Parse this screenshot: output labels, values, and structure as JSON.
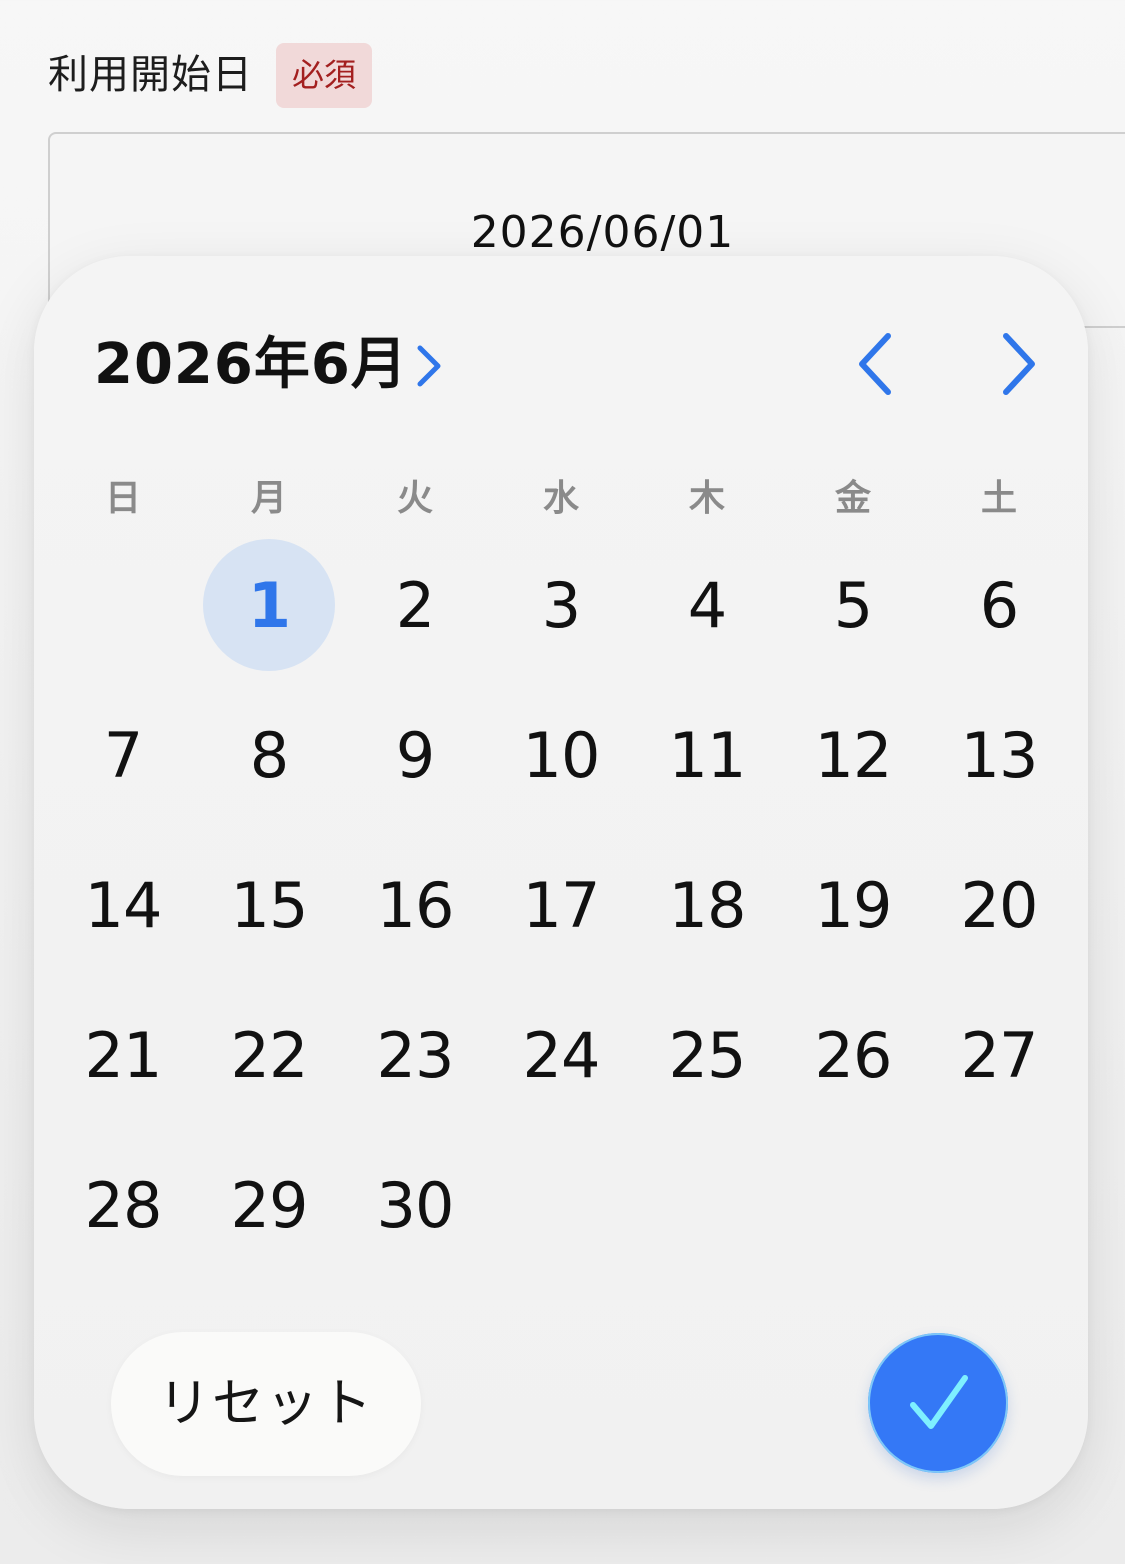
{
  "field": {
    "label": "利用開始日",
    "required_badge": "必須",
    "value": "2026/06/01"
  },
  "calendar": {
    "month_title": "2026年6月",
    "expand_icon": "chevron-right-icon",
    "prev_icon": "chevron-left-icon",
    "next_icon": "chevron-right-icon",
    "weekdays": [
      "日",
      "月",
      "火",
      "水",
      "木",
      "金",
      "土"
    ],
    "leading_blank_days": 1,
    "days_in_month": 30,
    "selected_day": "1",
    "days": [
      "1",
      "2",
      "3",
      "4",
      "5",
      "6",
      "7",
      "8",
      "9",
      "10",
      "11",
      "12",
      "13",
      "14",
      "15",
      "16",
      "17",
      "18",
      "19",
      "20",
      "21",
      "22",
      "23",
      "24",
      "25",
      "26",
      "27",
      "28",
      "29",
      "30"
    ]
  },
  "footer": {
    "reset_label": "リセット",
    "confirm_icon": "checkmark-icon"
  },
  "colors": {
    "accent": "#3478f6",
    "selected_bg": "#d7e3f3",
    "badge_bg": "#f1d9d9",
    "badge_text": "#a31f1f",
    "checkmark": "#7ef0ff"
  }
}
